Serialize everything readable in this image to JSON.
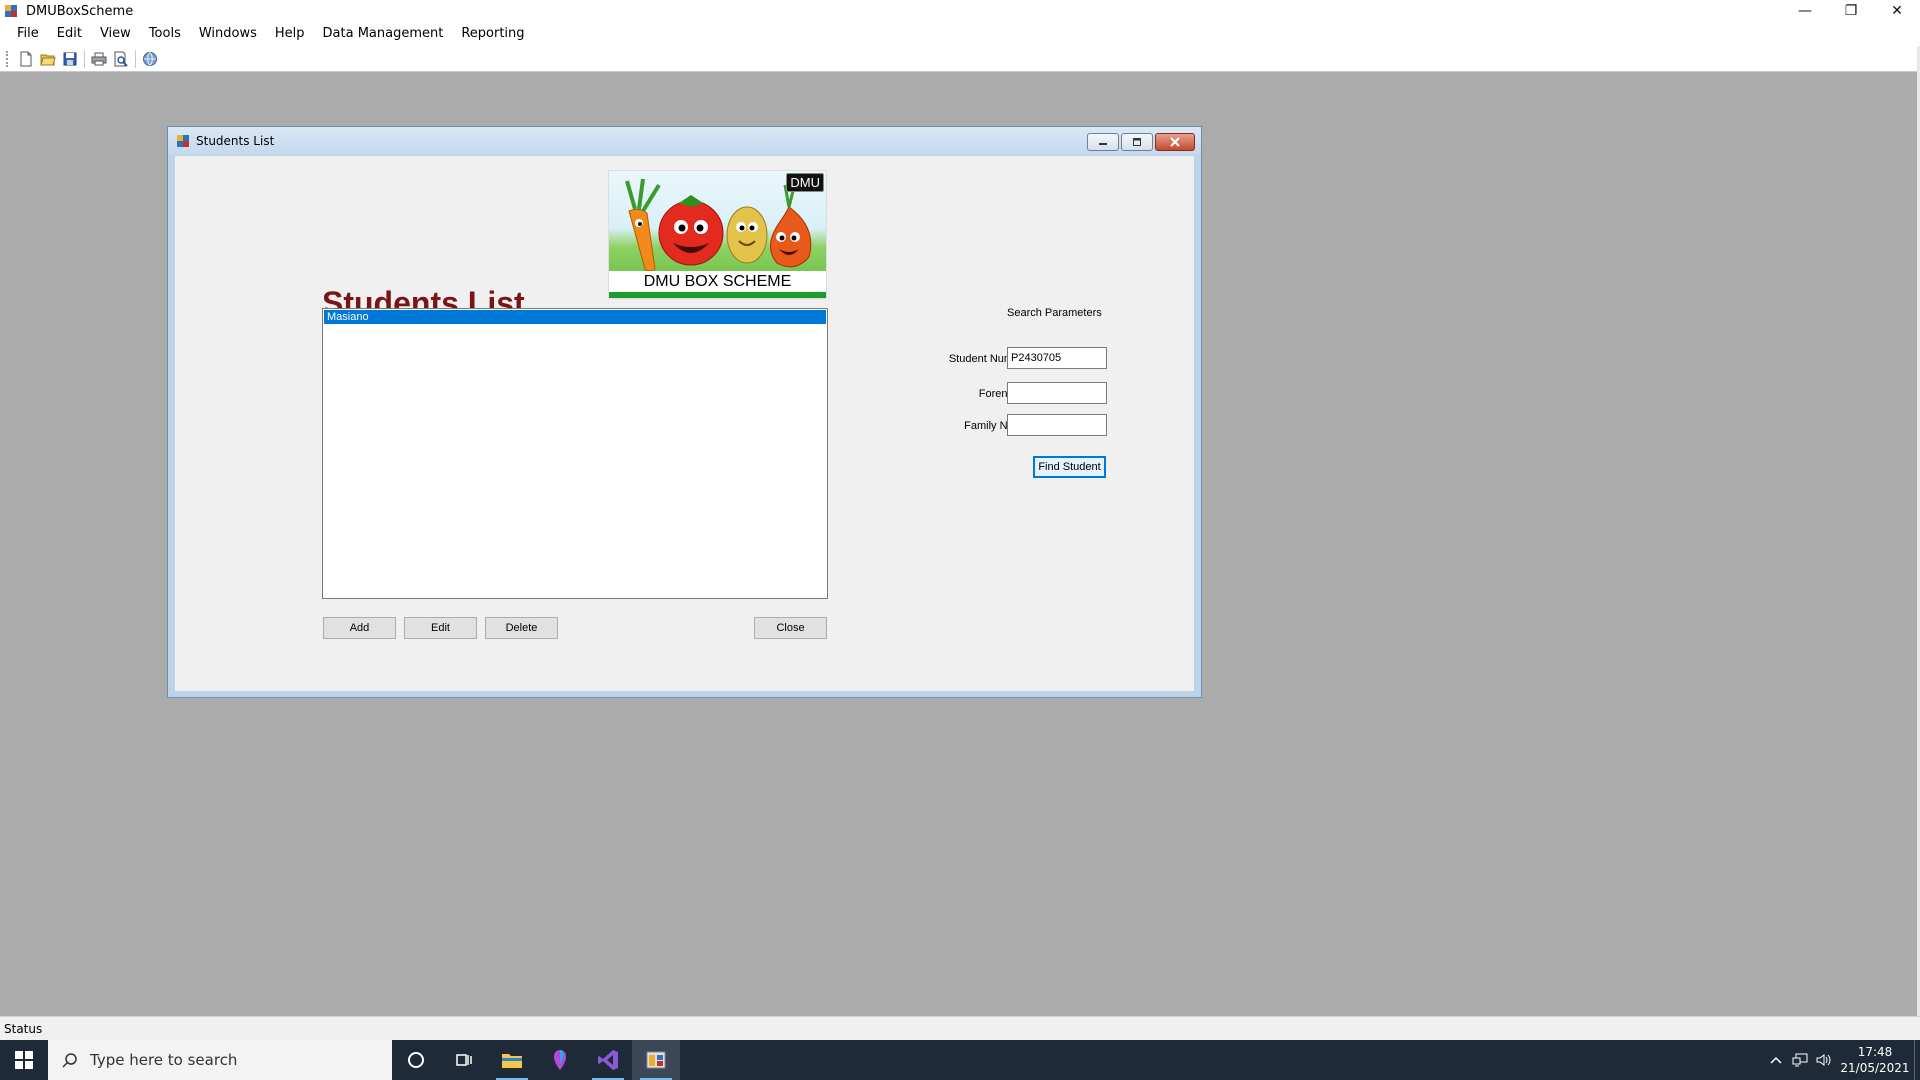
{
  "app": {
    "title": "DMUBoxScheme",
    "window_controls": {
      "minimize": "—",
      "restore": "❐",
      "close": "✕"
    }
  },
  "menu": {
    "items": [
      {
        "label": "File"
      },
      {
        "label": "Edit"
      },
      {
        "label": "View"
      },
      {
        "label": "Tools"
      },
      {
        "label": "Windows"
      },
      {
        "label": "Help"
      },
      {
        "label": "Data Management"
      },
      {
        "label": "Reporting"
      }
    ]
  },
  "toolbar": {
    "buttons": [
      "new-icon",
      "open-icon",
      "save-icon",
      "print-icon",
      "print-preview-icon",
      "help-icon"
    ]
  },
  "child_window": {
    "title": "Students List",
    "heading": "Students List",
    "logo": {
      "caption": "DMU BOX SCHEME",
      "badge": "DMU"
    },
    "list": {
      "items": [
        {
          "label": "Masiano",
          "selected": true
        }
      ]
    },
    "buttons": {
      "add": "Add",
      "edit": "Edit",
      "delete": "Delete",
      "close": "Close"
    },
    "search": {
      "title": "Search Parameters",
      "student_number_label": "Student Number:",
      "student_number_value": "P2430705",
      "forename_label": "Forename:",
      "forename_value": "",
      "family_name_label": "Family Name:",
      "family_name_value": "",
      "find_button": "Find Student"
    }
  },
  "statusbar": {
    "text": "Status"
  },
  "taskbar": {
    "search_placeholder": "Type here to search",
    "apps": [
      "cortana-icon",
      "task-view-icon",
      "file-explorer-icon",
      "paint-3d-icon",
      "visual-studio-icon",
      "dmuboxscheme-app-icon"
    ],
    "clock": {
      "time": "17:48",
      "date": "21/05/2021"
    }
  },
  "colors": {
    "heading": "#7b1414",
    "selection": "#0078d7",
    "mdi_background": "#ababab",
    "taskbar": "#1f2a38"
  }
}
